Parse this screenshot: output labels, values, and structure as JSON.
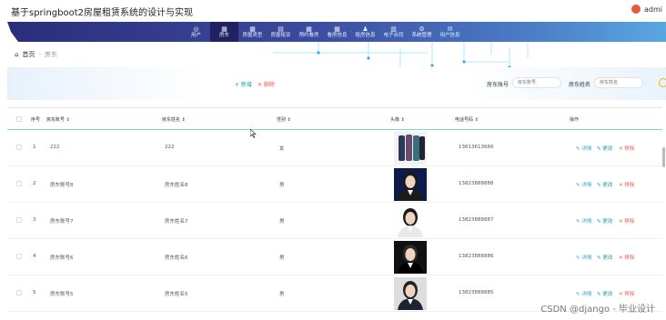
{
  "header": {
    "title": "基于springboot2房屋租赁系统的设计与实现",
    "user": "admi"
  },
  "nav": [
    {
      "label": "用户",
      "icon": "user-icon",
      "glyph": "◎",
      "active": false
    },
    {
      "label": "房东",
      "icon": "grid-icon",
      "glyph": "▦",
      "active": true
    },
    {
      "label": "房屋类型",
      "icon": "grid-icon",
      "glyph": "▦",
      "active": false
    },
    {
      "label": "房屋租赁",
      "icon": "stack-icon",
      "glyph": "▤",
      "active": false
    },
    {
      "label": "预约看房",
      "icon": "grid-icon",
      "glyph": "▦",
      "active": false
    },
    {
      "label": "看房信息",
      "icon": "grid-icon",
      "glyph": "▦",
      "active": false
    },
    {
      "label": "租房信息",
      "icon": "person-icon",
      "glyph": "♟",
      "active": false
    },
    {
      "label": "电子合同",
      "icon": "table-icon",
      "glyph": "▥",
      "active": false
    },
    {
      "label": "系统管理",
      "icon": "gear-icon",
      "glyph": "⚙",
      "active": false
    },
    {
      "label": "用户信息",
      "icon": "mail-icon",
      "glyph": "✉",
      "active": false
    }
  ],
  "breadcrumb": {
    "home": "首页",
    "sep": "-",
    "current": "房东"
  },
  "toolbar": {
    "add": "+ 新增",
    "delete": "✕ 删除",
    "filter1_label": "房东账号",
    "filter1_placeholder": "房东账号",
    "filter2_label": "房东姓名",
    "filter2_placeholder": "房东姓名"
  },
  "columns": {
    "idx": "序号",
    "account": "房东账号 ⇕",
    "name": "房东姓名 ⇕",
    "gender": "性别 ⇕",
    "avatar": "头像 ⇕",
    "phone": "电话号码 ⇕",
    "ops": "操作"
  },
  "actions": {
    "detail": "✎ 详情",
    "edit": "✎ 更改",
    "remove": "✕ 移除"
  },
  "rows": [
    {
      "idx": "1",
      "account": "222",
      "name": "222",
      "gender": "女",
      "phone": "13613613666",
      "photo": "phones"
    },
    {
      "idx": "2",
      "account": "房东账号8",
      "name": "房东姓名8",
      "gender": "男",
      "phone": "13823888888",
      "photo": "woman-dark"
    },
    {
      "idx": "3",
      "account": "房东账号7",
      "name": "房东姓名7",
      "gender": "男",
      "phone": "13823888887",
      "photo": "woman-light"
    },
    {
      "idx": "4",
      "account": "房东账号6",
      "name": "房东姓名6",
      "gender": "男",
      "phone": "13823888886",
      "photo": "woman-black"
    },
    {
      "idx": "5",
      "account": "房东账号5",
      "name": "房东姓名5",
      "gender": "男",
      "phone": "13823888885",
      "photo": "man-suit"
    }
  ],
  "watermark": "CSDN @django - 毕业设计",
  "colors": {
    "nav_dark": "#2b2e7a",
    "nav_light": "#5aa7e0",
    "teal": "#1aa0a0",
    "red": "#e25a5a"
  }
}
